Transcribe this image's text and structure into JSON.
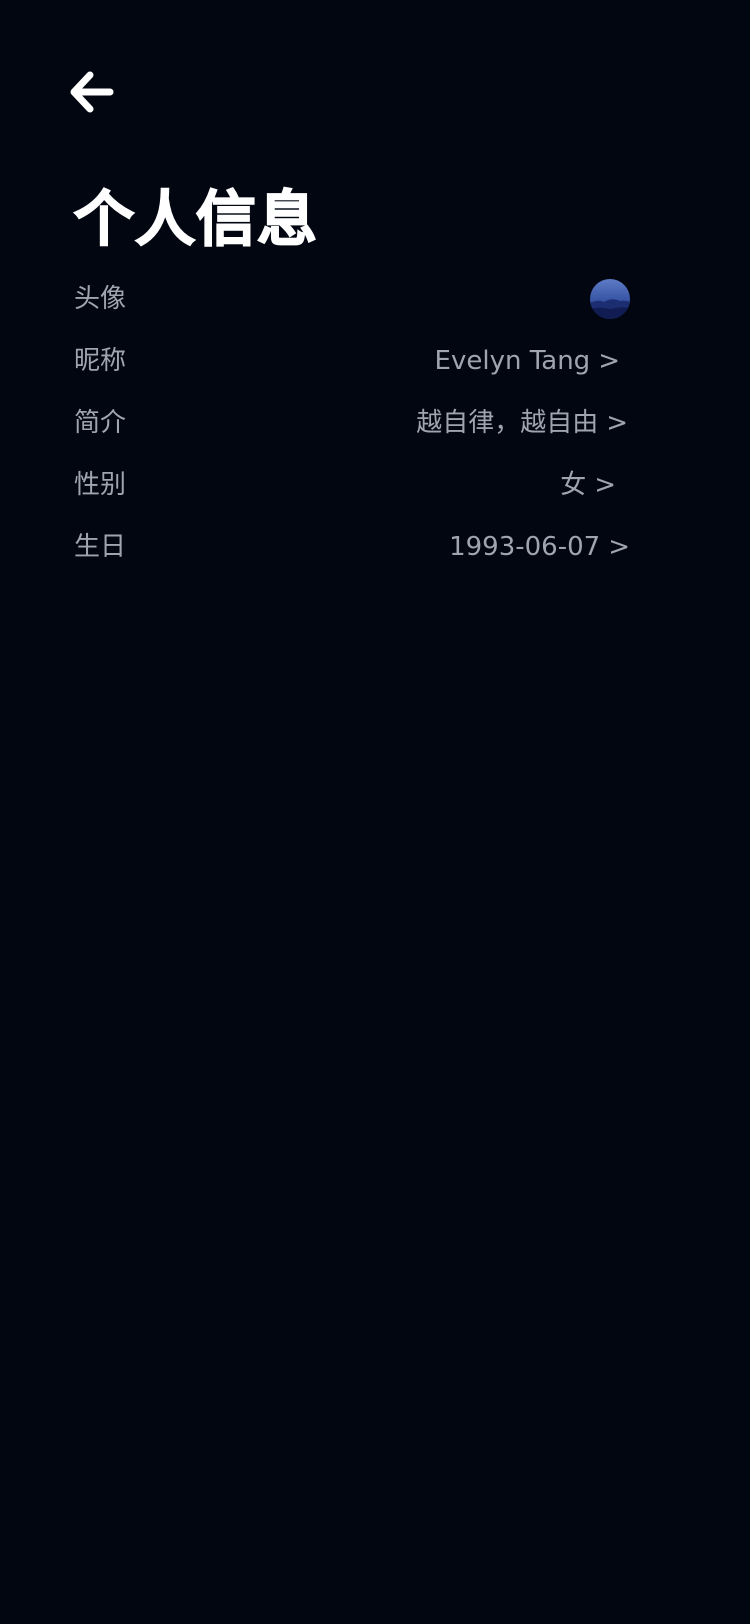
{
  "colors": {
    "background": "#010611",
    "title": "#ffffff",
    "label": "#a2a3b0",
    "value": "#a2a3b0"
  },
  "header": {
    "back_icon": "arrow-left-icon",
    "title": "个人信息"
  },
  "profile": {
    "avatar": {
      "label": "头像",
      "icon": "avatar-landscape-image"
    },
    "nickname": {
      "label": "昵称",
      "value": "Evelyn Tang",
      "chevron": ">"
    },
    "bio": {
      "label": "简介",
      "value": "越自律，越自由",
      "chevron": ">"
    },
    "gender": {
      "label": "性别",
      "value": "女",
      "chevron": ">"
    },
    "birthday": {
      "label": "生日",
      "value": "1993-06-07",
      "chevron": ">"
    }
  }
}
